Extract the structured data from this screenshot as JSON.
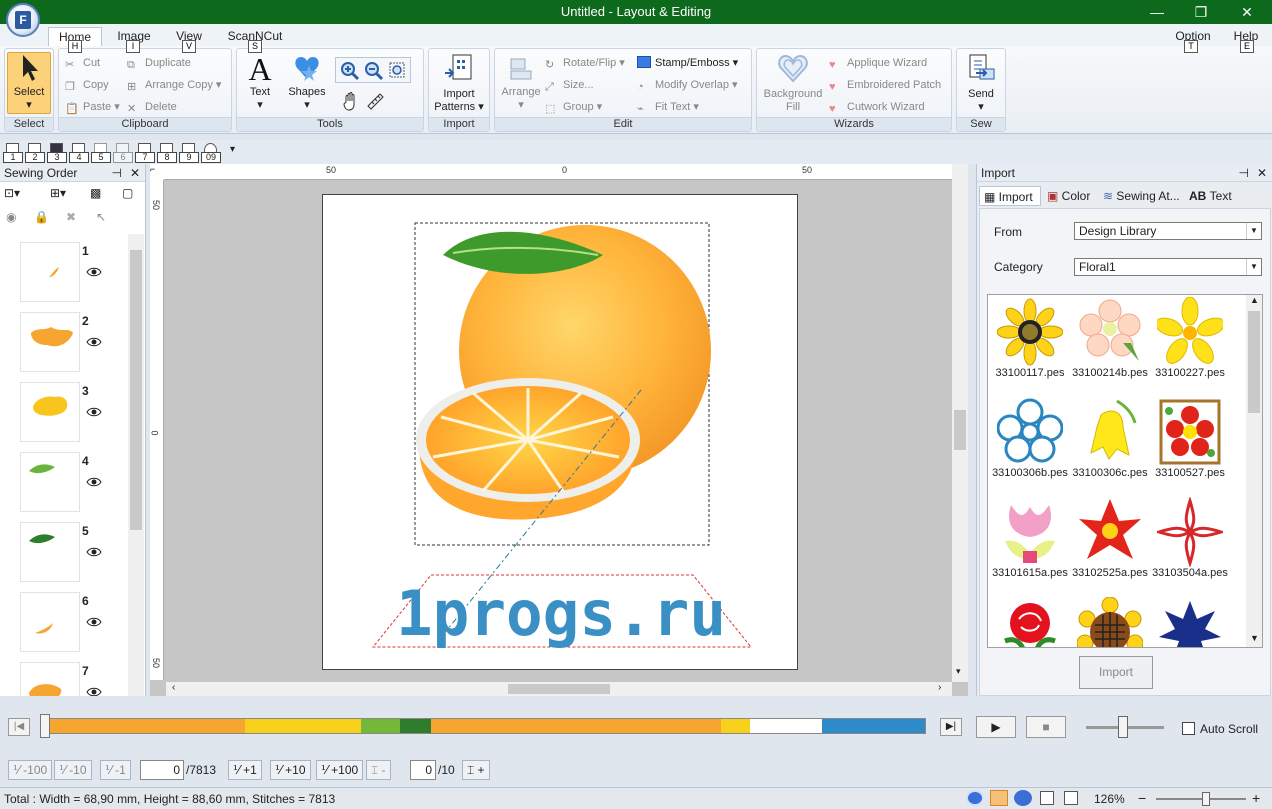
{
  "window": {
    "title": "Untitled - Layout & Editing",
    "minimize": "—",
    "maximize": "❐",
    "close": "✕"
  },
  "tabs": [
    {
      "label": "Home",
      "key": "H"
    },
    {
      "label": "Image",
      "key": "I"
    },
    {
      "label": "View",
      "key": "V"
    },
    {
      "label": "ScanNCut",
      "key": "S"
    }
  ],
  "right_tabs": [
    {
      "label": "Option",
      "key": "T"
    },
    {
      "label": "Help",
      "key": "E"
    }
  ],
  "ribbon": {
    "select": {
      "button": "Select",
      "label": "Select"
    },
    "clipboard": {
      "label": "Clipboard",
      "cut": "Cut",
      "copy": "Copy",
      "paste": "Paste",
      "duplicate": "Duplicate",
      "arrange_copy": "Arrange Copy",
      "delete": "Delete"
    },
    "tools": {
      "label": "Tools",
      "text": "Text",
      "shapes": "Shapes"
    },
    "import": {
      "label": "Import",
      "button_line1": "Import",
      "button_line2": "Patterns"
    },
    "edit": {
      "label": "Edit",
      "arrange": "Arrange",
      "rotate_flip": "Rotate/Flip",
      "size": "Size...",
      "group": "Group",
      "stamp_emboss": "Stamp/Emboss",
      "modify_overlap": "Modify Overlap",
      "fit_text": "Fit Text"
    },
    "wizards": {
      "label": "Wizards",
      "background_line1": "Background",
      "background_line2": "Fill",
      "applique": "Applique Wizard",
      "embroidered_patch": "Embroidered Patch",
      "cutwork": "Cutwork Wizard"
    },
    "sew": {
      "label": "Sew",
      "send": "Send"
    }
  },
  "quick_access": [
    "1",
    "2",
    "3",
    "4",
    "5",
    "6",
    "7",
    "8",
    "9",
    "09"
  ],
  "sewing_order": {
    "title": "Sewing Order",
    "items": [
      {
        "num": "1",
        "color": "#f7a531"
      },
      {
        "num": "2",
        "color": "#f7a531"
      },
      {
        "num": "3",
        "color": "#f8c51c"
      },
      {
        "num": "4",
        "color": "#6bb33a"
      },
      {
        "num": "5",
        "color": "#2f7d2c"
      },
      {
        "num": "6",
        "color": "#f7a531"
      },
      {
        "num": "7",
        "color": "#f7a531"
      }
    ]
  },
  "canvas": {
    "ruler_h": [
      "50",
      "0",
      "50"
    ],
    "ruler_v": [
      "50",
      "0",
      "50"
    ],
    "design_text": "1progs.ru"
  },
  "import_panel": {
    "title": "Import",
    "tabs": [
      "Import",
      "Color",
      "Sewing At...",
      "Text Attrib..."
    ],
    "from_label": "From",
    "from_value": "Design Library",
    "category_label": "Category",
    "category_value": "Floral1",
    "files": [
      "33100117.pes",
      "33100214b.pes",
      "33100227.pes",
      "33100306b.pes",
      "33100306c.pes",
      "33100527.pes",
      "33101615a.pes",
      "33102525a.pes",
      "33103504a.pes",
      "",
      "",
      ""
    ],
    "import_button": "Import"
  },
  "timeline": {
    "auto_scroll": "Auto Scroll",
    "segments": [
      {
        "color": "#f7a531",
        "w": 205
      },
      {
        "color": "#f8d11c",
        "w": 120
      },
      {
        "color": "#74b83a",
        "w": 40
      },
      {
        "color": "#2f7d2c",
        "w": 32
      },
      {
        "color": "#f7a531",
        "w": 22
      },
      {
        "color": "#f7a531",
        "w": 278
      },
      {
        "color": "#f8d11c",
        "w": 30
      },
      {
        "color": "#ffffff",
        "w": 75
      },
      {
        "color": "#2e8bc9",
        "w": 106
      }
    ]
  },
  "stitch_nav": {
    "m100": "-100",
    "m10": "-10",
    "m1": "-1",
    "stitch_value": "0",
    "stitch_total": "/7813",
    "p1": "+1",
    "p10": "+10",
    "p100": "+100",
    "color_minus": "-",
    "color_value": "0",
    "color_total": "/10",
    "color_plus": "+"
  },
  "status": {
    "text": "Total : Width = 68,90 mm, Height = 88,60 mm, Stitches = 7813",
    "zoom": "126%",
    "zoom_minus": "−",
    "zoom_plus": "+"
  }
}
